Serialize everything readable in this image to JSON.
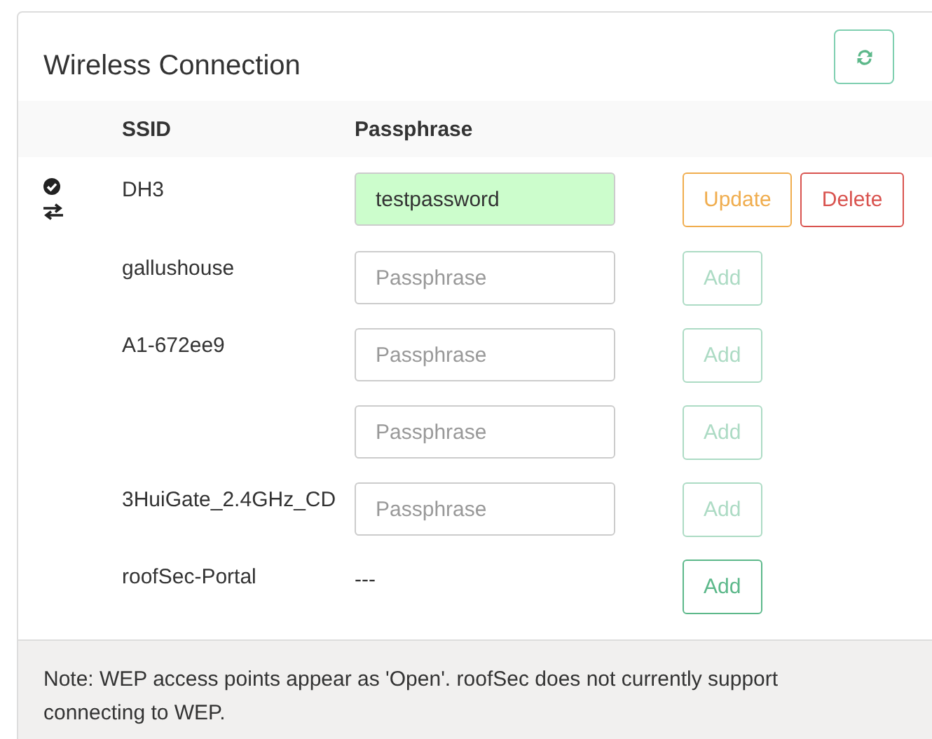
{
  "panel": {
    "title": "Wireless Connection"
  },
  "table": {
    "columns": [
      "SSID",
      "Passphrase"
    ],
    "rows": [
      {
        "ssid": "DH3",
        "connected": true,
        "active": true,
        "passphrase": {
          "kind": "field",
          "value": "testpassword",
          "saved": true
        },
        "buttons": [
          {
            "label": "Update",
            "kind": "update",
            "disabled": false
          },
          {
            "label": "Delete",
            "kind": "delete",
            "disabled": false
          }
        ]
      },
      {
        "ssid": "gallushouse",
        "connected": false,
        "active": false,
        "passphrase": {
          "kind": "field",
          "placeholder": "Passphrase",
          "saved": false
        },
        "buttons": [
          {
            "label": "Add",
            "kind": "add",
            "disabled": true
          }
        ]
      },
      {
        "ssid": "A1-672ee9",
        "connected": false,
        "active": false,
        "passphrase": {
          "kind": "field",
          "placeholder": "Passphrase",
          "saved": false
        },
        "buttons": [
          {
            "label": "Add",
            "kind": "add",
            "disabled": true
          }
        ]
      },
      {
        "connected": false,
        "active": false,
        "passphrase": {
          "kind": "field",
          "placeholder": "Passphrase",
          "saved": false
        },
        "buttons": [
          {
            "label": "Add",
            "kind": "add",
            "disabled": true
          }
        ]
      },
      {
        "ssid": "3HuiGate_2.4GHz_CD",
        "connected": false,
        "active": false,
        "passphrase": {
          "kind": "field",
          "placeholder": "Passphrase",
          "saved": false
        },
        "buttons": [
          {
            "label": "Add",
            "kind": "add",
            "disabled": true
          }
        ]
      },
      {
        "ssid": "roofSec-Portal",
        "connected": false,
        "active": false,
        "passphrase": {
          "kind": "open",
          "text": "---"
        },
        "buttons": [
          {
            "label": "Add",
            "kind": "add",
            "disabled": false
          }
        ]
      }
    ]
  },
  "footer": {
    "note": "Note: WEP access points appear as 'Open'. roofSec does not currently support connecting to WEP."
  }
}
